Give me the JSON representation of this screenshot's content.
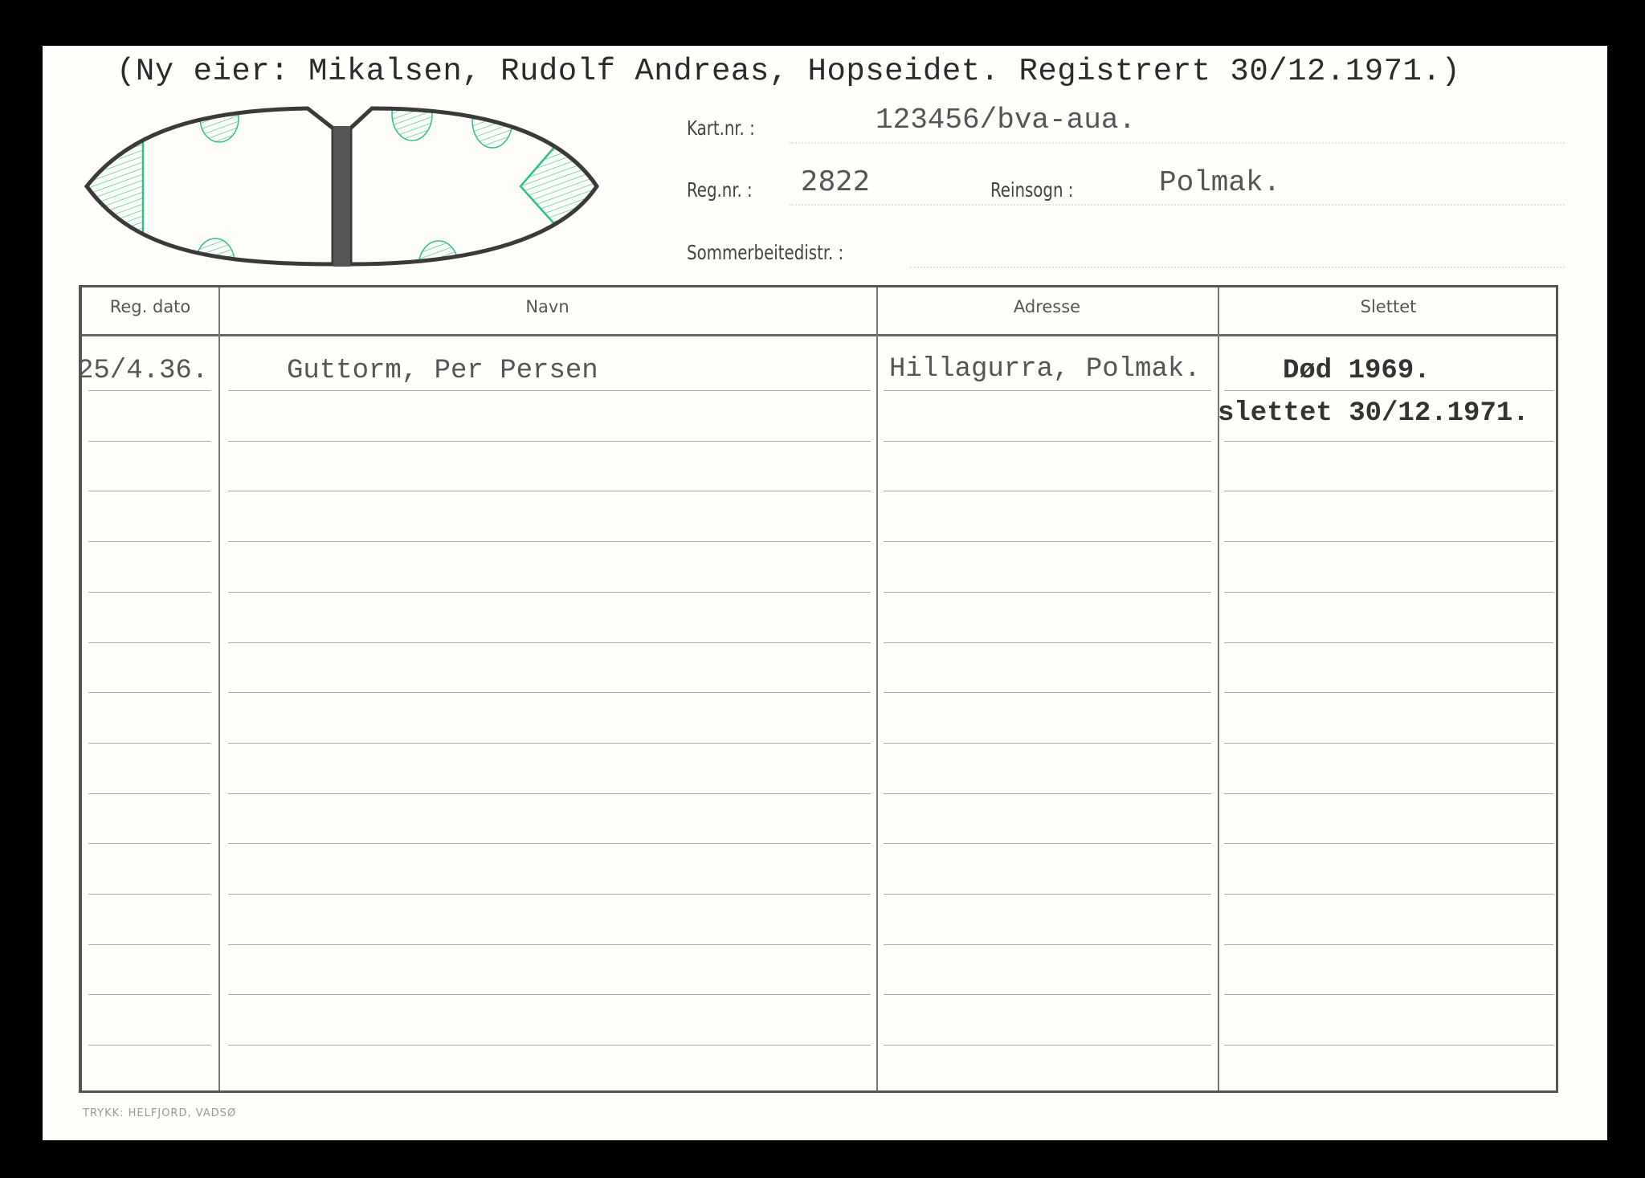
{
  "card": {
    "title": "(Ny eier: Mikalsen, Rudolf Andreas, Hopseidet. Registrert 30/12.1971.)",
    "fields": {
      "kart_label": "Kart.nr. :",
      "kart_value": "123456/bva-aua.",
      "reg_label": "Reg.nr. :",
      "reg_value": "2822",
      "reinsogn_label": "Reinsogn :",
      "reinsogn_value": "Polmak.",
      "sommer_label": "Sommerbeitedistr. :",
      "sommer_value": ""
    },
    "earmark": {
      "outline_color": "#3a3a3a",
      "mark_color": "#2fbf8a"
    },
    "table": {
      "headers": [
        "Reg. dato",
        "Navn",
        "Adresse",
        "Slettet"
      ],
      "rows": [
        {
          "reg_dato": "25/4.36.",
          "navn": "Guttorm, Per Persen",
          "adresse": "Hillagurra, Polmak.",
          "slettet_line1": "Død 1969.",
          "slettet_line2": "slettet 30/12.1971."
        }
      ]
    },
    "imprint": "TRYKK: HELFJORD, VADSØ"
  }
}
